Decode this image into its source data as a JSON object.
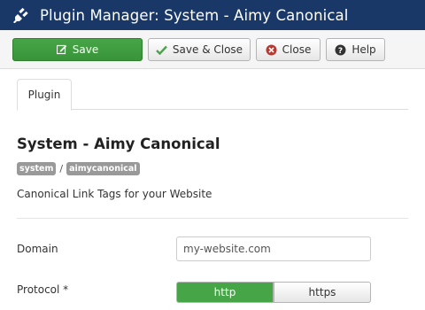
{
  "header": {
    "title": "Plugin Manager: System - Aimy Canonical",
    "icon": "plug-icon"
  },
  "toolbar": {
    "save_label": "Save",
    "save_close_label": "Save & Close",
    "close_label": "Close",
    "help_label": "Help"
  },
  "tabs": [
    {
      "label": "Plugin",
      "active": true
    }
  ],
  "plugin": {
    "name": "System - Aimy Canonical",
    "badges": [
      "system",
      "aimycanonical"
    ],
    "separator": "/",
    "description": "Canonical Link Tags for your Website"
  },
  "form": {
    "domain": {
      "label": "Domain",
      "value": "my-website.com"
    },
    "protocol": {
      "label": "Protocol *",
      "options": [
        "http",
        "https"
      ],
      "selected": "http"
    }
  },
  "colors": {
    "header_bg": "#1a3867",
    "save_green": "#46a546",
    "badge_gray": "#999999",
    "close_red": "#bd362f"
  }
}
